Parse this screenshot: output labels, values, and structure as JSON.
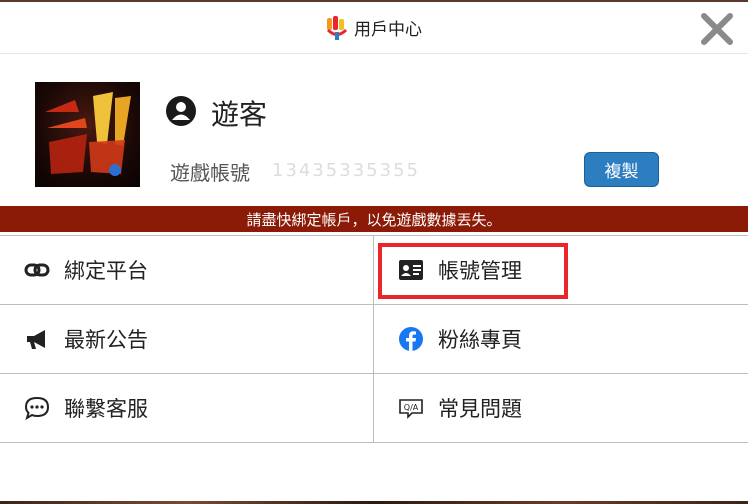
{
  "header": {
    "title": "用戶中心"
  },
  "profile": {
    "username": "遊客",
    "account_label": "遊戲帳號",
    "account_value": "13435335355",
    "copy_label": "複製"
  },
  "warning": "請盡快綁定帳戶，以免遊戲數據丟失。",
  "menu": {
    "bind_platform": "綁定平台",
    "account_manage": "帳號管理",
    "news": "最新公告",
    "fan_page": "粉絲專頁",
    "customer_service": "聯繫客服",
    "faq": "常見問題"
  },
  "colors": {
    "warning_bg": "#8b1a07",
    "copy_button": "#2c7ec1",
    "highlight": "#e8262b",
    "facebook": "#1877f2"
  },
  "icons": [
    "app-logo-icon",
    "close-icon",
    "user-icon",
    "link-icon",
    "id-card-icon",
    "megaphone-icon",
    "facebook-icon",
    "chat-bubble-icon",
    "qa-icon"
  ]
}
